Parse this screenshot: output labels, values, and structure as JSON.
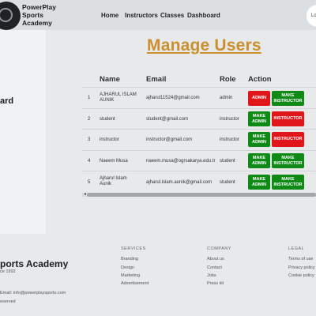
{
  "navbar": {
    "brand": "PowerPlay Sports Academy",
    "links": [
      "Home",
      "Instructors",
      "Classes",
      "Dashboard"
    ],
    "login_label": "Lo"
  },
  "sidebar": {
    "title": "ard"
  },
  "page_title": "Manage Users",
  "table": {
    "headers": [
      "Name",
      "Email",
      "Role",
      "Action"
    ],
    "rows": [
      {
        "index": "1",
        "name": "AJHARUL ISLAM AUNIK",
        "email": "ajharul11524@gmail.com",
        "role": "admin",
        "btn1": "ADMIN",
        "btn2": "MAKE INSTRUCTOR"
      },
      {
        "index": "2",
        "name": "student",
        "email": "student@gmail.com",
        "role": "instructor",
        "btn1": "MAKE ADMIN",
        "btn2": "INSTRUCTOR"
      },
      {
        "index": "3",
        "name": "instructor",
        "email": "instructor@gmail.com",
        "role": "instructor",
        "btn1": "MAKE ADMIN",
        "btn2": "INSTRUCTOR"
      },
      {
        "index": "4",
        "name": "Naeem Musa",
        "email": "naeem.musa@ogrsakarya.edu.tr",
        "role": "student",
        "btn1": "MAKE ADMIN",
        "btn2": "MAKE INSTRUCTOR"
      },
      {
        "index": "5",
        "name": "Ajharul Islam Aunik",
        "email": "ajharul.islam.aunik@gmail.com",
        "role": "student",
        "btn1": "MAKE ADMIN",
        "btn2": "MAKE INSTRUCTOR"
      }
    ]
  },
  "footer": {
    "brand": "ports Academy",
    "since": "ce 1992",
    "email": "Email: info@powerplaysports.com",
    "rights": "eserved",
    "services": {
      "title": "SERVICES",
      "items": [
        "Branding",
        "Design",
        "Marketing",
        "Advertisement"
      ]
    },
    "company": {
      "title": "COMPANY",
      "items": [
        "About us",
        "Contact",
        "Jobs",
        "Press kit"
      ]
    },
    "legal": {
      "title": "LEGAL",
      "items": [
        "Terms of use",
        "Privacy policy",
        "Cookie policy"
      ]
    }
  },
  "colors": {
    "accent_title": "#cb8f2d",
    "green": "#0f8a17",
    "red": "#e0161b"
  },
  "icons": {
    "logo": "circular-logo-icon",
    "scroll_left": "chevron-left-icon"
  }
}
